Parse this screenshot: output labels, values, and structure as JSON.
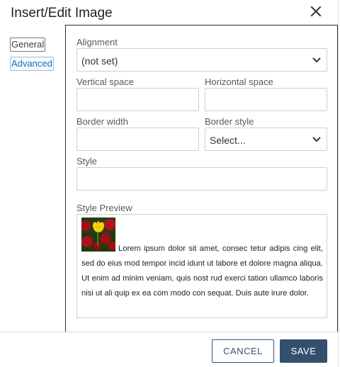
{
  "dialog": {
    "title": "Insert/Edit Image",
    "close_icon": "close-icon"
  },
  "tabs": [
    {
      "label": "General",
      "active": false
    },
    {
      "label": "Advanced",
      "active": true
    }
  ],
  "form": {
    "alignment": {
      "label": "Alignment",
      "value": "(not set)"
    },
    "vertical_space": {
      "label": "Vertical space",
      "value": ""
    },
    "horizontal_space": {
      "label": "Horizontal space",
      "value": ""
    },
    "border_width": {
      "label": "Border width",
      "value": ""
    },
    "border_style": {
      "label": "Border style",
      "value": "Select..."
    },
    "style": {
      "label": "Style",
      "value": ""
    },
    "style_preview": {
      "label": "Style Preview",
      "image": "tulip-thumbnail",
      "text": "Lorem ipsum dolor sit amet, consec tetur adipis cing elit, sed do eius mod tempor incid idunt ut labore et dolore magna aliqua. Ut enim ad minim veniam, quis nost rud exerci tation ullamco laboris nisi ut ali quip ex ea com modo con sequat. Duis aute irure dolor."
    }
  },
  "footer": {
    "cancel_label": "CANCEL",
    "save_label": "SAVE"
  },
  "colors": {
    "primary_button": "#34506f",
    "active_tab_text": "#1e6cb5"
  }
}
